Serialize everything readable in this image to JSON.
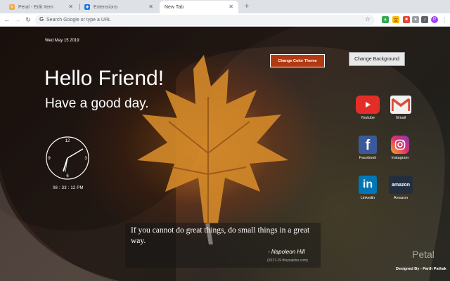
{
  "browser": {
    "tabs": [
      {
        "label": "Petal - Edit Item",
        "active": false
      },
      {
        "label": "Extensions",
        "active": false
      },
      {
        "label": "New Tab",
        "active": true
      }
    ],
    "omnibox_placeholder": "Search Google or type a URL",
    "extensions": [
      "drive-icon",
      "translate-icon",
      "red-ext-icon",
      "grey-ext-icon",
      "music-ext-icon",
      "profile-avatar",
      "menu-icon"
    ],
    "profile_initial": "P"
  },
  "page": {
    "date": "Wed May 15 2019",
    "greeting": "Hello Friend!",
    "subgreeting": "Have a good day.",
    "clock_time": "08 : 33 : 12 PM",
    "clock_numbers": [
      "12",
      "3",
      "6",
      "9"
    ],
    "buttons": {
      "theme": "Change Color Theme",
      "background": "Change Background"
    },
    "apps": [
      {
        "label": "Youtube",
        "icon": "youtube-icon",
        "color": "#e52d27"
      },
      {
        "label": "Gmail",
        "icon": "gmail-icon",
        "color": "#dd4b39"
      },
      {
        "label": "Facebook",
        "icon": "facebook-icon",
        "color": "#3b5998"
      },
      {
        "label": "Instagram",
        "icon": "instagram-icon",
        "color": "#c13584"
      },
      {
        "label": "Linkedin",
        "icon": "linkedin-icon",
        "color": "#0077b5"
      },
      {
        "label": "Amazon",
        "icon": "amazon-icon",
        "color": "#232f3e"
      }
    ],
    "quote": {
      "text": "If you cannot do great things, do small things in a great way.",
      "author": "- Napoleon Hill",
      "source": "(2017-19 theysaidso.com)"
    },
    "brand": "Petal",
    "credit": "Designed By - Parth Pathak"
  },
  "colors": {
    "theme_button": "#b23a12",
    "accent_purple": "#a142f4"
  }
}
